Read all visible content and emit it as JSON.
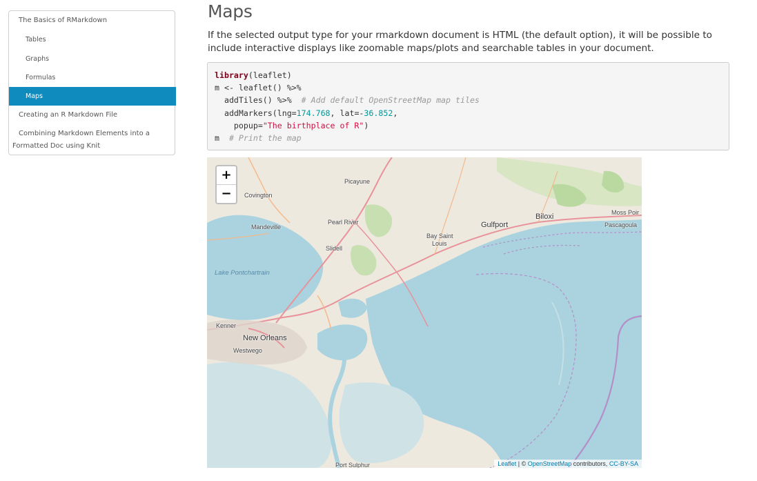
{
  "toc": {
    "items": [
      {
        "label": "The Basics of RMarkdown"
      },
      {
        "label": "Tables"
      },
      {
        "label": "Graphs"
      },
      {
        "label": "Formulas"
      },
      {
        "label": "Maps"
      },
      {
        "label": "Creating an R Markdown File"
      },
      {
        "label": "Combining Markdown Elements into a"
      },
      {
        "label": "Formatted Doc using Knit"
      }
    ]
  },
  "main": {
    "title": "Maps",
    "intro": "If the selected output type for your rmarkdown document is HTML (the default option), it will be possible to include interactive displays like zoomable maps/plots and searchable tables in your document.",
    "code": {
      "l1_fn": "library",
      "l1_rest": "(leaflet)",
      "l2": "m <- leaflet() %>%",
      "l3_code": "  addTiles() %>%  ",
      "l3_comment": "# Add default OpenStreetMap map tiles",
      "l4_a": "  addMarkers(lng=",
      "l4_n1": "174.768",
      "l4_b": ", lat=-",
      "l4_n2": "36.852",
      "l4_c": ",",
      "l5_a": "    popup=",
      "l5_str": "\"The birthplace of R\"",
      "l5_b": ")",
      "l6_code": "m  ",
      "l6_comment": "# Print the map"
    }
  },
  "map": {
    "zoom_in": "+",
    "zoom_out": "−",
    "places": {
      "picayune": "Picayune",
      "covington": "Covington",
      "mandeville": "Mandeville",
      "pearl_river": "Pearl River",
      "slidell": "Slidell",
      "gulfport": "Gulfport",
      "biloxi": "Biloxi",
      "moss_point": "Moss Poir",
      "pascagoula": "Pascagoula",
      "bay_saint_louis_1": "Bay Saint",
      "bay_saint_louis_2": "Louis",
      "lake_pontchartrain": "Lake Pontchartrain",
      "kenner": "Kenner",
      "new_orleans": "New Orleans",
      "westwego": "Westwego",
      "port_sulphur": "Port Sulphur"
    },
    "attribution": {
      "leaflet": "Leaflet",
      "sep": " | © ",
      "osm": "OpenStreetMap",
      "contributors": " contributors, ",
      "license": "CC-BY-SA"
    },
    "colors": {
      "water": "#aad3df",
      "land": "#eee9df",
      "forest": "#c8dfb2",
      "roads": "#e8929a",
      "boundary": "#b48ec8"
    }
  }
}
